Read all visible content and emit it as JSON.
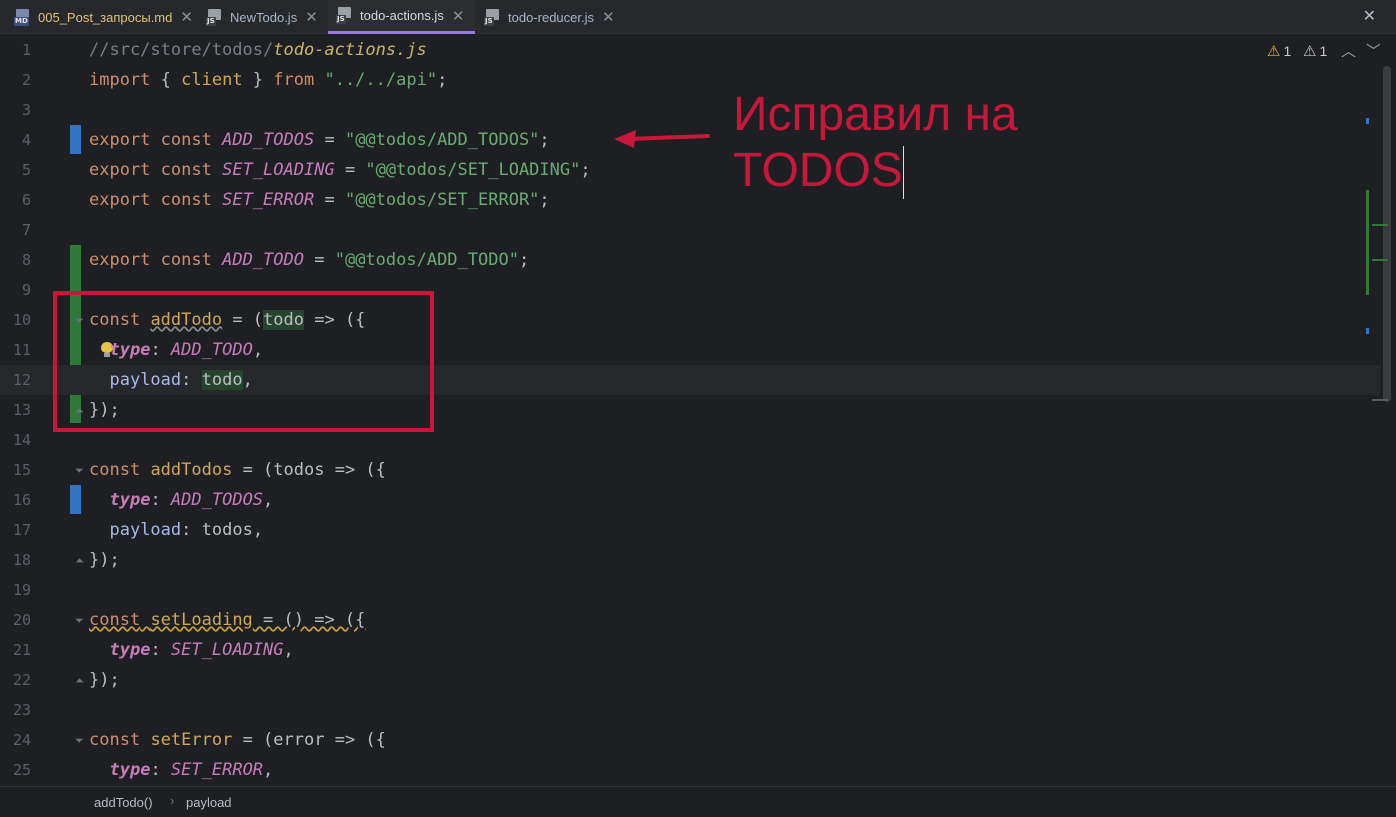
{
  "tabs": [
    {
      "label": "005_Post_запросы.md",
      "icon": "markdown-file-icon",
      "badge": "MD"
    },
    {
      "label": "NewTodo.js",
      "icon": "js-file-icon",
      "badge": "JS"
    },
    {
      "label": "todo-actions.js",
      "icon": "js-file-icon",
      "badge": "JS",
      "active": true
    },
    {
      "label": "todo-reducer.js",
      "icon": "js-file-icon",
      "badge": "JS"
    }
  ],
  "tab_close": "✕",
  "line_numbers": [
    "1",
    "2",
    "3",
    "4",
    "5",
    "6",
    "7",
    "8",
    "9",
    "10",
    "11",
    "12",
    "13",
    "14",
    "15",
    "16",
    "17",
    "18",
    "19",
    "20",
    "21",
    "22",
    "23",
    "24",
    "25"
  ],
  "code": {
    "l1_comment": "//src/store/todos/",
    "l1_file": "todo-actions.js",
    "import_kw": "import",
    "brace_open": " { ",
    "client": "client",
    "brace_close": " } ",
    "from_kw": "from",
    "api_path": " \"../../api\"",
    "export_kw": "export",
    "const_kw": "const",
    "ADD_TODOS": "ADD_TODOS",
    "ADD_TODOS_str": "\"@@todos/ADD_TODOS\"",
    "SET_LOADING": "SET_LOADING",
    "SET_LOADING_str": "\"@@todos/SET_LOADING\"",
    "SET_ERROR": "SET_ERROR",
    "SET_ERROR_str": "\"@@todos/SET_ERROR\"",
    "ADD_TODO": "ADD_TODO",
    "ADD_TODO_str": "\"@@todos/ADD_TODO\"",
    "addTodo": "addTodo",
    "addTodos": "addTodos",
    "setLoading": "setLoading",
    "setError": "setError",
    "type_key": "type",
    "payload_key": "payload",
    "todo_param": "todo",
    "todos_param": "todos",
    "error_param": "error",
    "eq": " = ",
    "semi": ";",
    "arrow": " => ({",
    "close_obj": "});"
  },
  "warnings": {
    "warn_count": "1",
    "weak_warn_count": "1"
  },
  "annotation": {
    "line1": "Исправил на",
    "line2": "TODOS"
  },
  "breadcrumb": {
    "fn": "addTodo()",
    "sep": "›",
    "prop": "payload"
  },
  "colors": {
    "annotation": "#c8173c",
    "active_tab_underline": "#9a7be0",
    "gutter_modified": "#3574c4",
    "gutter_added": "#2f7a3a"
  }
}
